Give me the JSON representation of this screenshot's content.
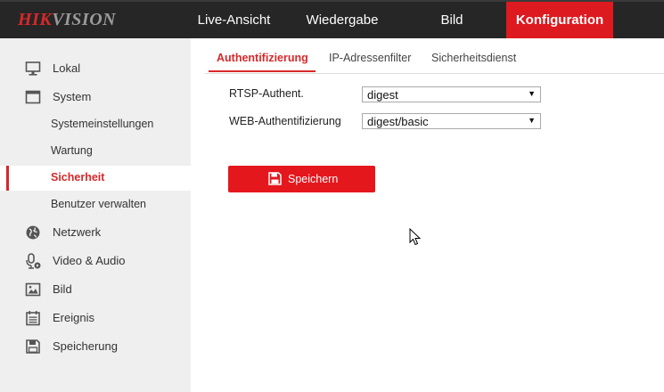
{
  "brand": {
    "logo_red": "HIK",
    "logo_grey": "VISION"
  },
  "nav": {
    "live": "Live-Ansicht",
    "playback": "Wiedergabe",
    "picture": "Bild",
    "config": "Konfiguration"
  },
  "sidebar": {
    "items": [
      {
        "label": "Lokal",
        "icon": "monitor-icon"
      },
      {
        "label": "System",
        "icon": "window-icon"
      },
      {
        "label": "Systemeinstellungen"
      },
      {
        "label": "Wartung"
      },
      {
        "label": "Sicherheit"
      },
      {
        "label": "Benutzer verwalten"
      },
      {
        "label": "Netzwerk",
        "icon": "globe-icon"
      },
      {
        "label": "Video & Audio",
        "icon": "microphone-icon"
      },
      {
        "label": "Bild",
        "icon": "image-icon"
      },
      {
        "label": "Ereignis",
        "icon": "calendar-icon"
      },
      {
        "label": "Speicherung",
        "icon": "floppy-icon"
      }
    ]
  },
  "tabs": {
    "auth": "Authentifizierung",
    "ip_filter": "IP-Adressenfilter",
    "security_service": "Sicherheitsdienst"
  },
  "form": {
    "rtsp_label": "RTSP-Authent.",
    "rtsp_value": "digest",
    "web_label": "WEB-Authentifizierung",
    "web_value": "digest/basic",
    "save_label": "Speichern"
  },
  "colors": {
    "accent": "#dd1a1f",
    "topbar": "#262626",
    "sidebar": "#efefef"
  }
}
